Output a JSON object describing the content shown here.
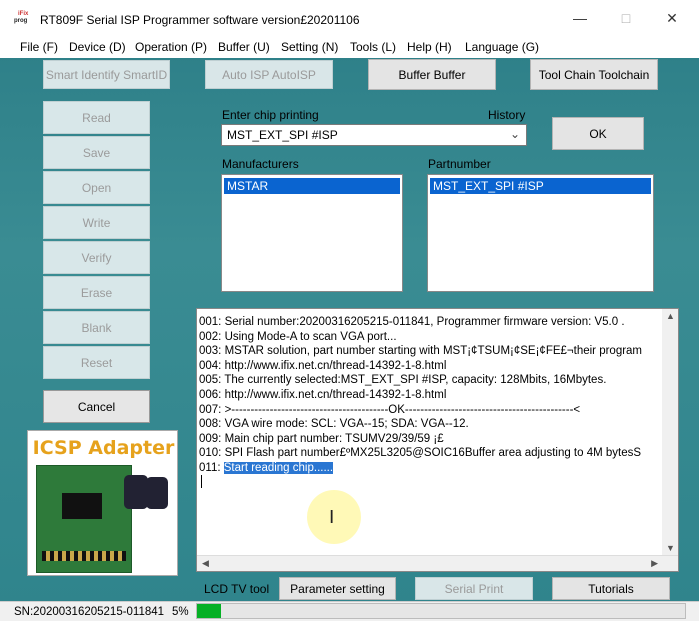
{
  "window": {
    "title": "RT809F Serial ISP Programmer software version£20201106",
    "logo_lines": [
      "iFix",
      "prog"
    ],
    "controls": {
      "minimize": "—",
      "maximize": "□",
      "close": "✕"
    }
  },
  "menu": [
    {
      "label": "File (F)"
    },
    {
      "label": "Device (D)"
    },
    {
      "label": "Operation (P)"
    },
    {
      "label": "Buffer (U)"
    },
    {
      "label": "Setting (N)"
    },
    {
      "label": "Tools (L)"
    },
    {
      "label": "Help (H)"
    },
    {
      "label": "Language (G)"
    }
  ],
  "toolbar": {
    "smart_identify": "Smart Identify SmartID",
    "auto_isp": "Auto ISP AutoISP",
    "buffer": "Buffer Buffer",
    "tool_chain": "Tool Chain Toolchain"
  },
  "side_buttons": [
    "Read",
    "Save",
    "Open",
    "Write",
    "Verify",
    "Erase",
    "Blank",
    "Reset"
  ],
  "cancel_label": "Cancel",
  "chip": {
    "enter_label": "Enter chip printing",
    "history_label": "History",
    "select_value": "MST_EXT_SPI #ISP",
    "ok_label": "OK",
    "manufacturers_label": "Manufacturers",
    "manufacturers": [
      "MSTAR"
    ],
    "partnumber_label": "Partnumber",
    "partnumbers": [
      "MST_EXT_SPI #ISP"
    ]
  },
  "log": [
    "001:  Serial number:20200316205215-011841, Programmer firmware version: V5.0 .",
    "002:  Using Mode-A to scan VGA port...",
    "003:  MSTAR solution, part number starting with MST¡¢TSUM¡¢SE¡¢FE£¬their program",
    "004:  http://www.ifix.net.cn/thread-14392-1-8.html",
    "005:  The currently selected:MST_EXT_SPI #ISP, capacity: 128Mbits, 16Mbytes.",
    "006:  http://www.ifix.net.cn/thread-14392-1-8.html",
    "007:  >-----------------------------------------OK--------------------------------------------<",
    "008:  VGA wire mode: SCL: VGA--15; SDA: VGA--12.",
    "009:  Main chip part number: TSUMV29/39/59 ¡£",
    "010:  SPI Flash part number£ºMX25L3205@SOIC16Buffer area adjusting to 4M bytesS"
  ],
  "log_last": {
    "prefix": "011:  ",
    "text": "Start reading chip......"
  },
  "icsp": {
    "title": "ICSP Adapter"
  },
  "bottom": {
    "lcd_label": "LCD TV tool",
    "parameter_setting": "Parameter setting",
    "serial_print": "Serial Print",
    "tutorials": "Tutorials"
  },
  "status": {
    "serial": "SN:20200316205215-011841",
    "percent": "5%",
    "progress_fraction": 0.05,
    "progress_color": "#06b025"
  }
}
